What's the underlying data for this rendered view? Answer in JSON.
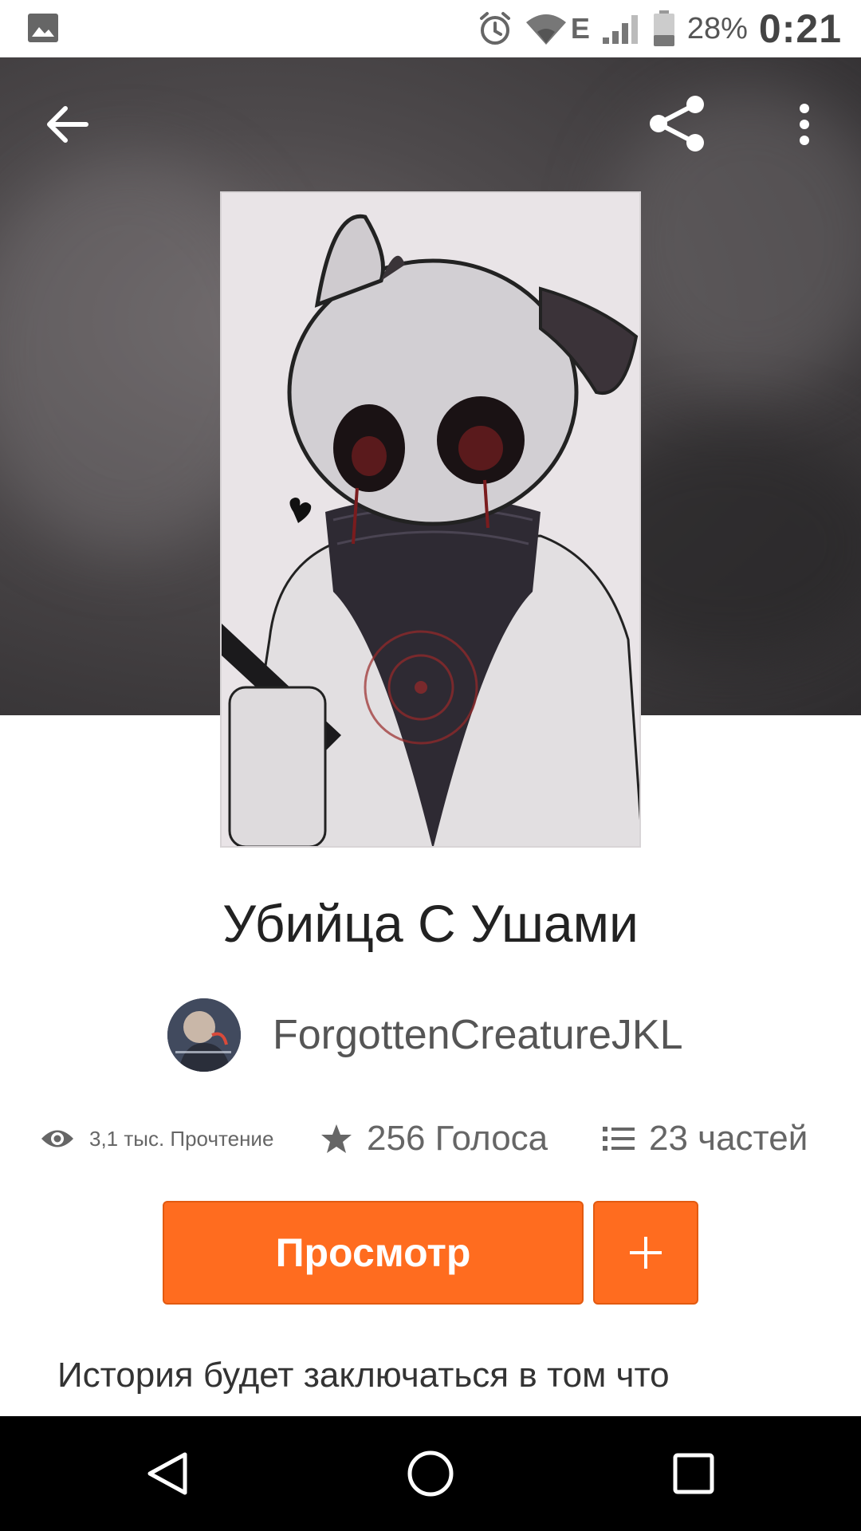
{
  "status_bar": {
    "battery_percent": "28%",
    "time": "0:21",
    "network_type": "E",
    "icons": [
      "image-icon",
      "alarm-icon",
      "wifi-icon",
      "signal-icon",
      "battery-icon"
    ]
  },
  "header": {
    "icons": [
      "back-arrow-icon",
      "share-icon",
      "more-vert-icon"
    ]
  },
  "story": {
    "title": "Убийца С Ушами",
    "author": "ForgottenCreatureJKL",
    "stats": {
      "reads": "3,1 тыс. Прочтение",
      "votes": "256 Голоса",
      "parts": "23 частей"
    },
    "description": "История будет заключаться в том что"
  },
  "actions": {
    "read_label": "Просмотр",
    "add_label": "+"
  },
  "nav_bar": {
    "icons": [
      "nav-back-icon",
      "nav-home-icon",
      "nav-recents-icon"
    ]
  },
  "colors": {
    "accent": "#ff6c1f",
    "nav_background": "#000000",
    "text_dark": "#222222",
    "text_muted": "#666666"
  }
}
